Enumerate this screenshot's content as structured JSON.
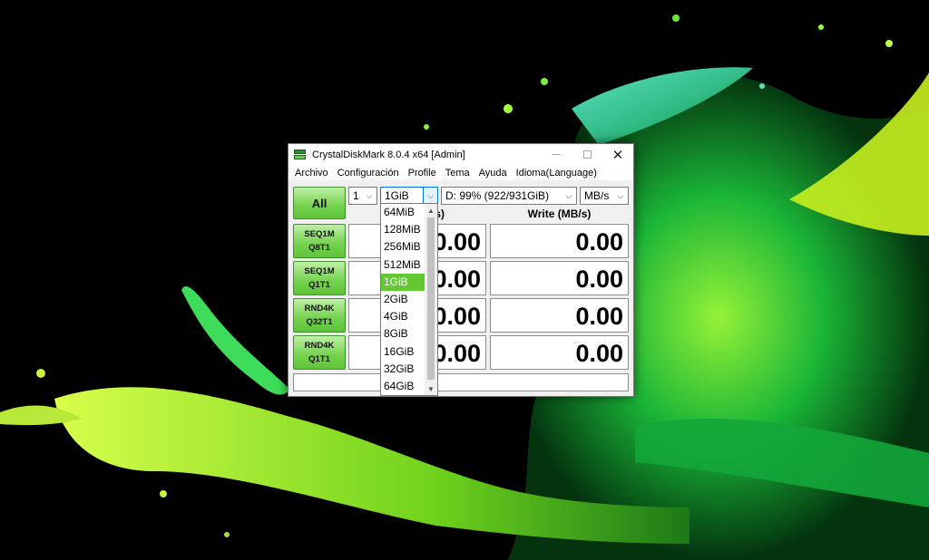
{
  "window": {
    "title": "CrystalDiskMark 8.0.4 x64 [Admin]",
    "close_glyph": "✕"
  },
  "menu": [
    "Archivo",
    "Configuración",
    "Profile",
    "Tema",
    "Ayuda",
    "Idioma(Language)"
  ],
  "controls": {
    "all_label": "All",
    "count_value": "1",
    "size_value": "1GiB",
    "drive_value": "D: 99% (922/931GiB)",
    "unit_value": "MB/s"
  },
  "columns": {
    "read_partial": "/s)",
    "write": "Write (MB/s)"
  },
  "tests": [
    {
      "line1": "SEQ1M",
      "line2": "Q8T1",
      "read": "0.00",
      "write": "0.00"
    },
    {
      "line1": "SEQ1M",
      "line2": "Q1T1",
      "read": "0.00",
      "write": "0.00"
    },
    {
      "line1": "RND4K",
      "line2": "Q32T1",
      "read": "0.00",
      "write": "0.00"
    },
    {
      "line1": "RND4K",
      "line2": "Q1T1",
      "read": "0.00",
      "write": "0.00"
    }
  ],
  "size_dropdown": {
    "options": [
      "64MiB",
      "128MiB",
      "256MiB",
      "512MiB",
      "1GiB",
      "2GiB",
      "4GiB",
      "8GiB",
      "16GiB",
      "32GiB",
      "64GiB"
    ],
    "selected": "1GiB"
  },
  "colors": {
    "button_green": "#73d24d",
    "selected_green": "#62c933",
    "focus_blue": "#0078d7"
  },
  "icons": {
    "dropdown_arrow": "chevron-down-icon",
    "app": "crystaldiskmark-app-icon"
  }
}
